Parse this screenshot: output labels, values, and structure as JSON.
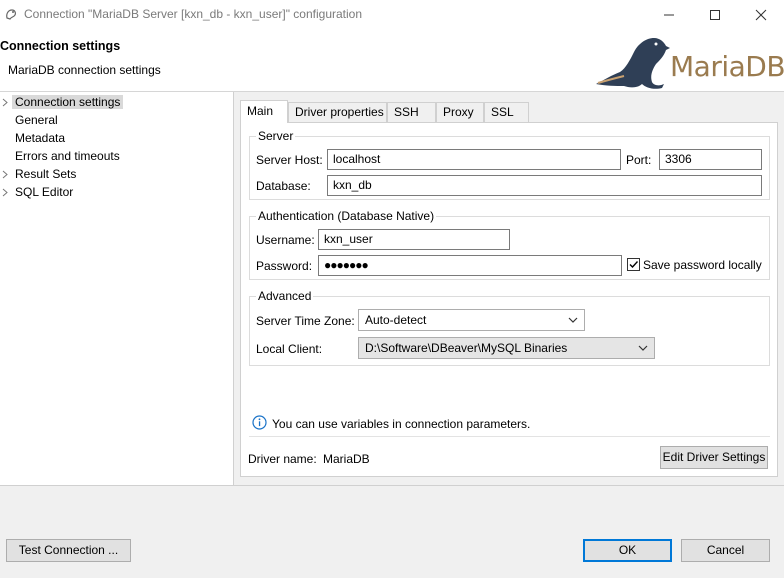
{
  "window": {
    "title": "Connection \"MariaDB Server [kxn_db - kxn_user]\" configuration",
    "controls": {
      "minimize": "—",
      "maximize": "☐",
      "close": "✕"
    }
  },
  "header": {
    "title": "Connection settings",
    "subtitle": "MariaDB connection settings",
    "logo_text": "MariaDB",
    "logo_color": "#9a7b4f",
    "seal_color": "#2f3f56"
  },
  "tree": {
    "items": [
      {
        "label": "Connection settings",
        "expandable": true,
        "selected": true,
        "indent": false
      },
      {
        "label": "General",
        "expandable": false,
        "selected": false,
        "indent": true
      },
      {
        "label": "Metadata",
        "expandable": false,
        "selected": false,
        "indent": true
      },
      {
        "label": "Errors and timeouts",
        "expandable": false,
        "selected": false,
        "indent": true
      },
      {
        "label": "Result Sets",
        "expandable": true,
        "selected": false,
        "indent": false
      },
      {
        "label": "SQL Editor",
        "expandable": true,
        "selected": false,
        "indent": false
      }
    ]
  },
  "tabs": [
    {
      "label": "Main",
      "active": true
    },
    {
      "label": "Driver properties",
      "active": false
    },
    {
      "label": "SSH",
      "active": false
    },
    {
      "label": "Proxy",
      "active": false
    },
    {
      "label": "SSL",
      "active": false
    }
  ],
  "server": {
    "group_title": "Server",
    "host_label": "Server Host:",
    "host_value": "localhost",
    "port_label": "Port:",
    "port_value": "3306",
    "database_label": "Database:",
    "database_value": "kxn_db"
  },
  "auth": {
    "group_title": "Authentication (Database Native)",
    "username_label": "Username:",
    "username_value": "kxn_user",
    "password_label": "Password:",
    "password_value": "●●●●●●●",
    "save_password_label": "Save password locally",
    "save_password_checked": true
  },
  "advanced": {
    "group_title": "Advanced",
    "timezone_label": "Server Time Zone:",
    "timezone_value": "Auto-detect",
    "client_label": "Local Client:",
    "client_value": "D:\\Software\\DBeaver\\MySQL Binaries"
  },
  "info": {
    "icon": "info-icon",
    "text": "You can use variables in connection parameters."
  },
  "driver": {
    "name_label": "Driver name:",
    "name_value": "MariaDB",
    "edit_button": "Edit Driver Settings"
  },
  "footer": {
    "test_button": "Test Connection ...",
    "ok_button": "OK",
    "cancel_button": "Cancel"
  },
  "colors": {
    "accent": "#0078d7",
    "selection": "#d9d9d9",
    "info_icon": "#1a73c8"
  }
}
